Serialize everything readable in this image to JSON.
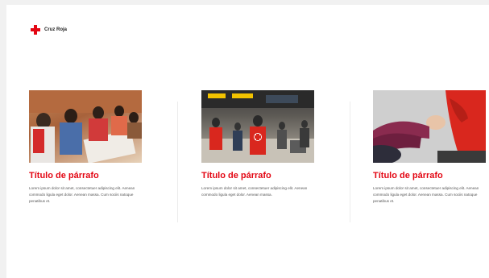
{
  "header": {
    "brand_name": "Cruz Roja",
    "logo_icon": "red-cross-icon",
    "brand_color": "#e30613"
  },
  "cards": [
    {
      "title": "Título de párrafo",
      "body": "Lorem ipsum dolor sit amet, consectetuer adipiscing elit. Aenean commodo ligula eget dolor. Aenean massa. Cum sociis natoque penatibus et."
    },
    {
      "title": "Título de párrafo",
      "body": "Lorem ipsum dolor sit amet, consectetuer adipiscing elit. Aenean commodo ligula eget dolor. Aenean massa."
    },
    {
      "title": "Título de párrafo",
      "body": "Lorem ipsum dolor sit amet, consectetuer adipiscing elit. Aenean commodo ligula eget dolor. Aenean massa. Cum sociis natoque penatibus et."
    }
  ]
}
